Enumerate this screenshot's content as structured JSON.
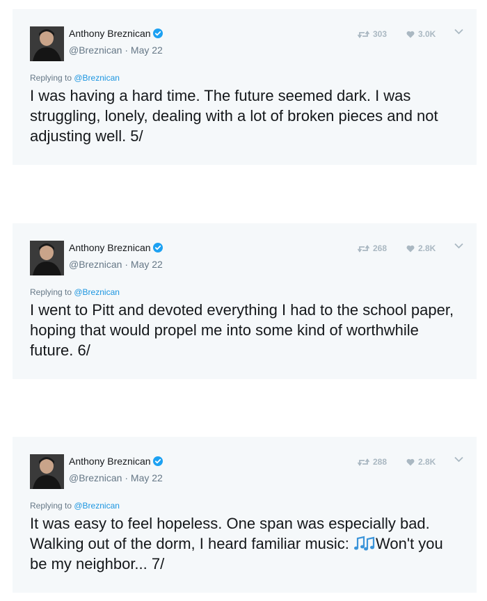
{
  "tweets": [
    {
      "author_name": "Anthony Breznican",
      "handle": "@Breznican",
      "separator": " · ",
      "date": "May 22",
      "retweets": "303",
      "likes": "3.0K",
      "replying_prefix": "Replying to ",
      "replying_to": "@Breznican",
      "text": "I was having a hard time. The future seemed dark. I was\nstruggling, lonely, dealing with a lot of broken pieces and not\nadjusting well. 5/"
    },
    {
      "author_name": "Anthony Breznican",
      "handle": "@Breznican",
      "separator": " · ",
      "date": "May 22",
      "retweets": "268",
      "likes": "2.8K",
      "replying_prefix": "Replying to ",
      "replying_to": "@Breznican",
      "text": "I went to Pitt and devoted everything I had to the school paper,\nhoping that would propel me into some kind of worthwhile\nfuture. 6/"
    },
    {
      "author_name": "Anthony Breznican",
      "handle": "@Breznican",
      "separator": " · ",
      "date": "May 22",
      "retweets": "288",
      "likes": "2.8K",
      "replying_prefix": "Replying to ",
      "replying_to": "@Breznican",
      "text_before_emoji": "It was easy to feel hopeless. One  span was especially bad.\nWalking out of the dorm, I heard familiar music: ",
      "emoji": "musical-notes",
      "text_after_emoji": "Won't you\nbe my neighbor... 7/"
    }
  ],
  "colors": {
    "card_bg": "#f5f8fa",
    "text": "#14171a",
    "muted": "#657786",
    "link": "#1b95e0",
    "verified": "#1da1f2",
    "action": "#aab8c2"
  }
}
